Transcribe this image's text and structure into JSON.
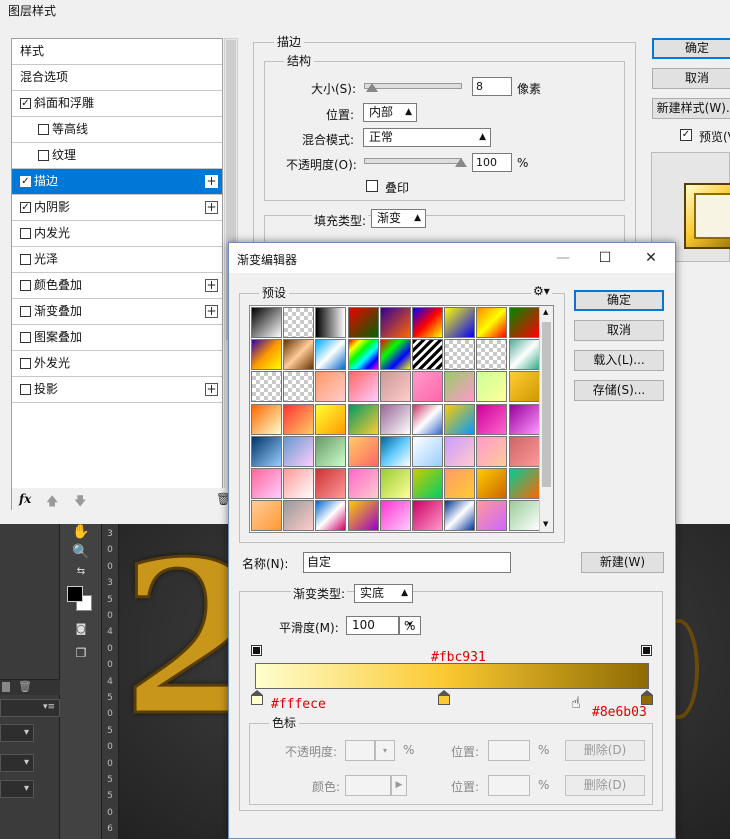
{
  "layer_style": {
    "title": "图层样式",
    "styles": [
      {
        "label": "样式",
        "checkbox": false,
        "checked": false,
        "plus": false,
        "selected": false,
        "indent": false
      },
      {
        "label": "混合选项",
        "checkbox": false,
        "checked": false,
        "plus": false,
        "selected": false,
        "indent": false
      },
      {
        "label": "斜面和浮雕",
        "checkbox": true,
        "checked": true,
        "plus": false,
        "selected": false,
        "indent": false
      },
      {
        "label": "等高线",
        "checkbox": true,
        "checked": false,
        "plus": false,
        "selected": false,
        "indent": true
      },
      {
        "label": "纹理",
        "checkbox": true,
        "checked": false,
        "plus": false,
        "selected": false,
        "indent": true
      },
      {
        "label": "描边",
        "checkbox": true,
        "checked": true,
        "plus": true,
        "selected": true,
        "indent": false
      },
      {
        "label": "内阴影",
        "checkbox": true,
        "checked": true,
        "plus": true,
        "selected": false,
        "indent": false
      },
      {
        "label": "内发光",
        "checkbox": true,
        "checked": false,
        "plus": false,
        "selected": false,
        "indent": false
      },
      {
        "label": "光泽",
        "checkbox": true,
        "checked": false,
        "plus": false,
        "selected": false,
        "indent": false
      },
      {
        "label": "颜色叠加",
        "checkbox": true,
        "checked": false,
        "plus": true,
        "selected": false,
        "indent": false
      },
      {
        "label": "渐变叠加",
        "checkbox": true,
        "checked": false,
        "plus": true,
        "selected": false,
        "indent": false
      },
      {
        "label": "图案叠加",
        "checkbox": true,
        "checked": false,
        "plus": false,
        "selected": false,
        "indent": false
      },
      {
        "label": "外发光",
        "checkbox": true,
        "checked": false,
        "plus": false,
        "selected": false,
        "indent": false
      },
      {
        "label": "投影",
        "checkbox": true,
        "checked": false,
        "plus": true,
        "selected": false,
        "indent": false
      }
    ],
    "footer_fx": "fx",
    "stroke": {
      "group_title": "描边",
      "structure_title": "结构",
      "size_label": "大小(S):",
      "size_value": "8",
      "size_unit": "像素",
      "position_label": "位置:",
      "position_value": "内部",
      "blend_label": "混合模式:",
      "blend_value": "正常",
      "opacity_label": "不透明度(O):",
      "opacity_value": "100",
      "opacity_unit": "%",
      "overprint_label": "叠印",
      "fill_type_label": "填充类型:",
      "fill_type_value": "渐变"
    },
    "buttons": {
      "ok": "确定",
      "cancel": "取消",
      "new_style": "新建样式(W)...",
      "preview": "预览(V)"
    }
  },
  "gradient_editor": {
    "title": "渐变编辑器",
    "presets_label": "预设",
    "buttons": {
      "ok": "确定",
      "cancel": "取消",
      "load": "载入(L)...",
      "save": "存储(S)...",
      "new": "新建(W)"
    },
    "name_label": "名称(N):",
    "name_value": "自定",
    "gradient_type_label": "渐变类型:",
    "gradient_type_value": "实底",
    "smoothness_label": "平滑度(M):",
    "smoothness_value": "100",
    "smoothness_unit": "%",
    "stops": {
      "left_color": "#fffece",
      "mid_color": "#fbc931",
      "right_color": "#8e6b03",
      "mid_location": 0.48
    },
    "color_stops": {
      "group_title": "色标",
      "opacity_label": "不透明度:",
      "opacity_unit": "%",
      "location_label": "位置:",
      "location_unit": "%",
      "delete_label": "删除(D)",
      "color_label": "颜色:"
    }
  },
  "workspace": {
    "ruler_marks": [
      "3",
      "0",
      "0",
      "3",
      "5",
      "0",
      "4",
      "0",
      "0",
      "4",
      "5",
      "0",
      "5",
      "0",
      "0",
      "5",
      "5",
      "0",
      "6"
    ]
  }
}
